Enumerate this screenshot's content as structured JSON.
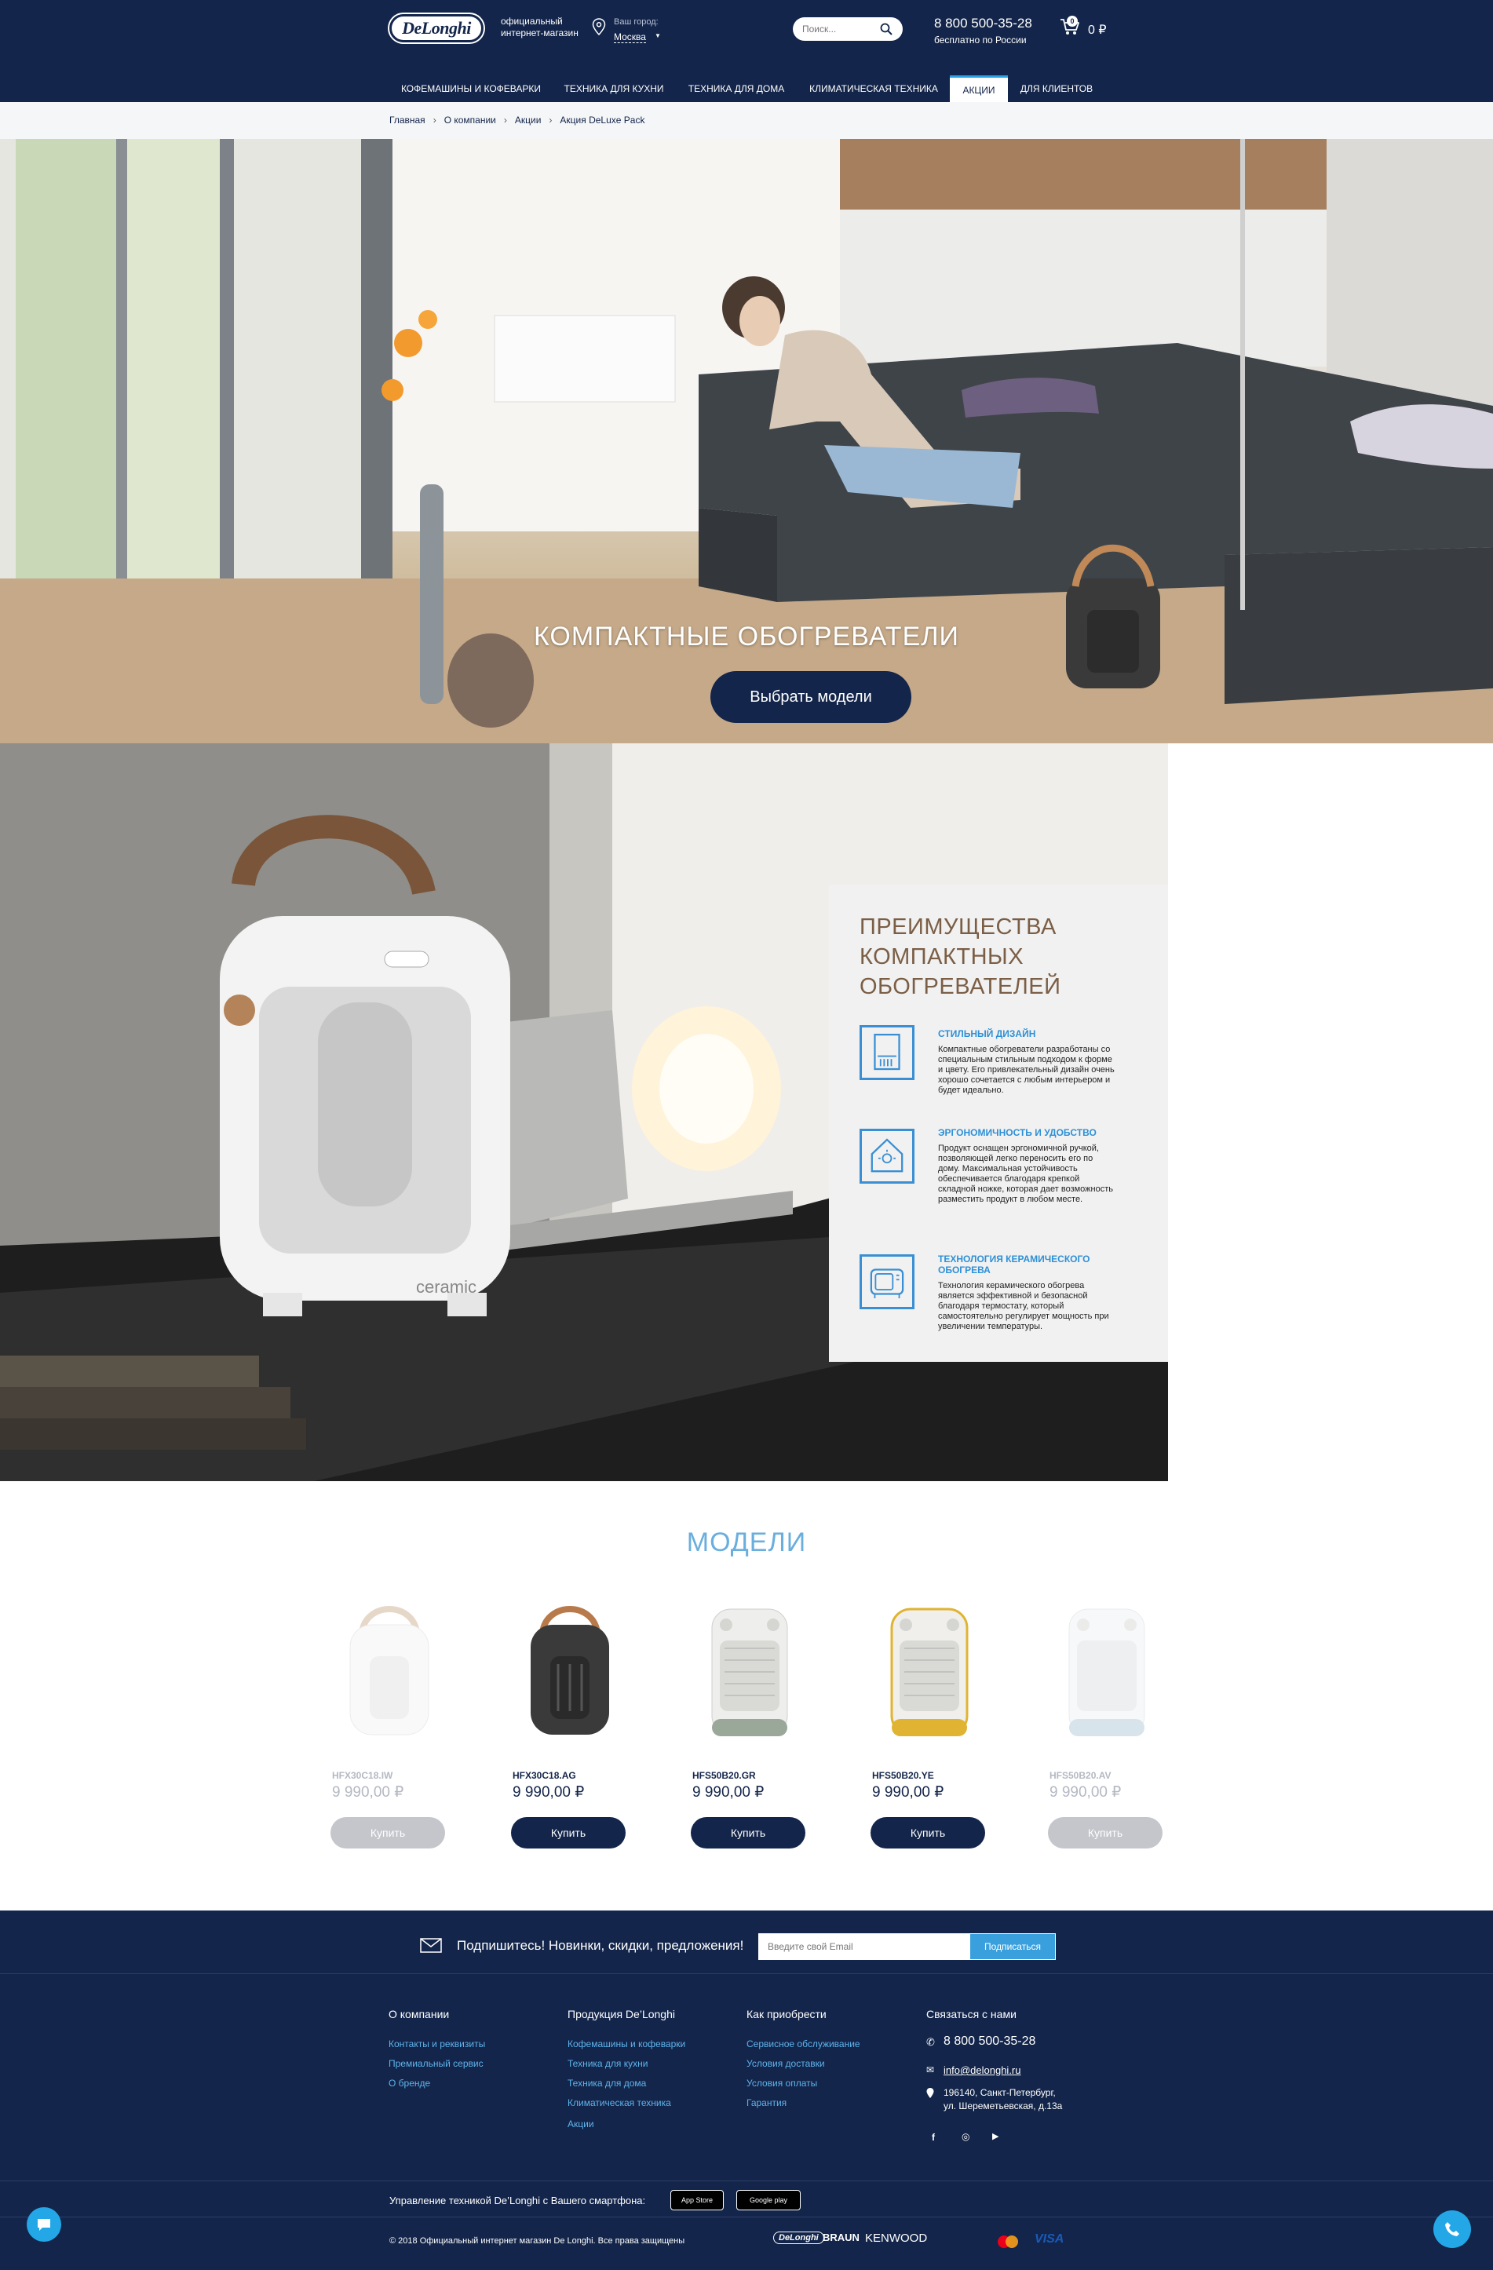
{
  "header": {
    "logo_text": "DeLonghi",
    "tagline": "официальный интернет-магазин",
    "city_caption": "Ваш город:",
    "city_value": "Москва",
    "search_placeholder": "Поиск...",
    "phone": "8 800 500-35-28",
    "phone_note": "бесплатно по России",
    "cart_count": "0",
    "cart_total": "0 ₽"
  },
  "nav": [
    {
      "label": "КОФЕМАШИНЫ И КОФЕВАРКИ"
    },
    {
      "label": "ТЕХНИКА ДЛЯ КУХНИ"
    },
    {
      "label": "ТЕХНИКА ДЛЯ ДОМА"
    },
    {
      "label": "КЛИМАТИЧЕСКАЯ ТЕХНИКА"
    },
    {
      "label": "АКЦИИ",
      "active": true
    },
    {
      "label": "ДЛЯ КЛИЕНТОВ"
    }
  ],
  "breadcrumb": [
    "Главная",
    "О компании",
    "Акции",
    "Акция DeLuxe Pack"
  ],
  "hero": {
    "title": "КОМПАКТНЫЕ ОБОГРЕВАТЕЛИ",
    "button": "Выбрать модели"
  },
  "benefits": {
    "title": "ПРЕИМУЩЕСТВА КОМПАКТНЫХ ОБОГРЕВАТЕЛЕЙ",
    "heater_brand": "ceramic",
    "features": [
      {
        "icon": "stylish-design-icon",
        "title": "СТИЛЬНЫЙ ДИЗАЙН",
        "text": "Компактные обогреватели разработаны со специальным стильным подходом к форме и цвету. Его привлекательный дизайн очень хорошо сочетается с любым интерьером и будет идеально."
      },
      {
        "icon": "ergonomic-home-icon",
        "title": "ЭРГОНОМИЧНОСТЬ И УДОБСТВО",
        "text": "Продукт оснащен эргономичной ручкой, позволяющей легко переносить его по дому. Максимальная устойчивость обеспечивается благодаря крепкой складной ножке, которая дает возможность разместить продукт в любом месте."
      },
      {
        "icon": "ceramic-heater-icon",
        "title": "ТЕХНОЛОГИЯ КЕРАМИЧЕСКОГО ОБОГРЕВА",
        "text": "Технология керамического обогрева является эффективной и безопасной благодаря термостату, который самостоятельно регулирует мощность при увеличении температуры."
      }
    ]
  },
  "models": {
    "title": "МОДЕЛИ",
    "items": [
      {
        "name": "HFX30C18.IW",
        "price": "9 990,00 ₽",
        "buy": "Купить",
        "body_color": "#f2f2f2",
        "accent": "#c9a98a"
      },
      {
        "name": "HFX30C18.AG",
        "price": "9 990,00 ₽",
        "buy": "Купить",
        "body_color": "#3a3a3a",
        "accent": "#b87a4a"
      },
      {
        "name": "HFS50B20.GR",
        "price": "9 990,00 ₽",
        "buy": "Купить",
        "body_color": "#eeeeec",
        "accent": "#9aa89a"
      },
      {
        "name": "HFS50B20.YE",
        "price": "9 990,00 ₽",
        "buy": "Купить",
        "body_color": "#f0efec",
        "accent": "#e0b432"
      },
      {
        "name": "HFS50B20.AV",
        "price": "9 990,00 ₽",
        "buy": "Купить",
        "body_color": "#eef0f2",
        "accent": "#a9c4d6"
      }
    ]
  },
  "subscribe": {
    "text": "Подпишитесь! Новинки, скидки, предложения!",
    "placeholder": "Введите свой Email",
    "button": "Подписаться"
  },
  "footer": {
    "columns": [
      {
        "title": "О компании",
        "links": [
          "Контакты и реквизиты",
          "Премиальный сервис",
          "О бренде"
        ]
      },
      {
        "title": "Продукция De’Longhi",
        "links": [
          "Кофемашины и кофеварки",
          "Техника для кухни",
          "Техника для дома",
          "Климатическая техника",
          "Акции"
        ]
      },
      {
        "title": "Как приобрести",
        "links": [
          "Сервисное обслуживание",
          "Условия доставки",
          "Условия оплаты",
          "Гарантия"
        ]
      }
    ],
    "contacts": {
      "title": "Связаться с нами",
      "phone": "8 800 500-35-28",
      "email": "info@delonghi.ru",
      "address_line1": "196140, Санкт-Петербург,",
      "address_line2": "ул. Шереметьевская, д.13а"
    },
    "app_text": "Управление техникой De’Longhi с Вашего смартфона:",
    "app_store": "App Store",
    "google_play": "Google play",
    "copyright": "© 2018 Официальный интернет магазин De Longhi. Все права защищены",
    "brands": [
      "DeLonghi",
      "BRAUN",
      "KENWOOD"
    ],
    "payments": [
      "MasterCard",
      "VISA"
    ]
  }
}
